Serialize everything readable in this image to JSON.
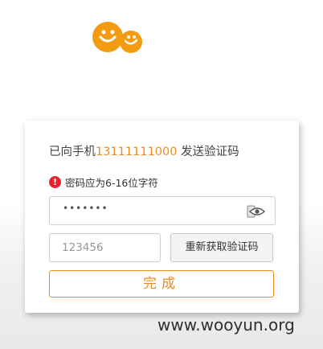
{
  "logo": {
    "icon": "orange-mascot-logo-icon",
    "color": "#f39c12"
  },
  "card": {
    "sent_prefix": "已向手机",
    "phone": "13111111000",
    "sent_suffix": " 发送验证码",
    "error_icon": "!",
    "error_text": "密码应为6-16位字符",
    "password_value": "•••••••",
    "password_toggle_icon": "eye-icon",
    "code_placeholder": "123456",
    "resend_label": "重新获取验证码",
    "done_label": "完成"
  },
  "watermark": "www.wooyun.org",
  "colors": {
    "accent": "#f08c1c",
    "error": "#e7242c"
  }
}
